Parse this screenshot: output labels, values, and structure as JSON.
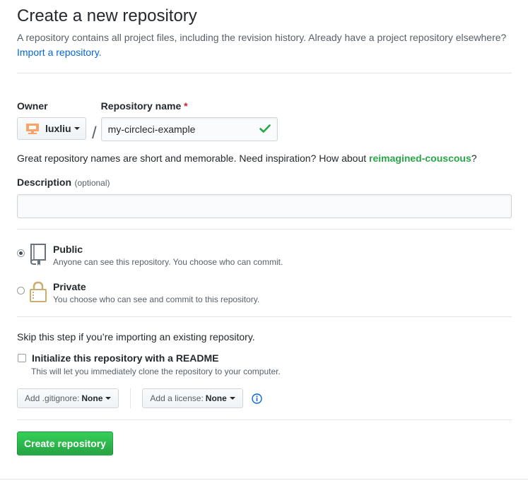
{
  "header": {
    "title": "Create a new repository",
    "description": "A repository contains all project files, including the revision history. Already have a project repository elsewhere?",
    "import_link": "Import a repository."
  },
  "owner": {
    "label": "Owner",
    "value": "luxliu"
  },
  "repo_name": {
    "label": "Repository name",
    "required_mark": "*",
    "value": "my-circleci-example"
  },
  "separator": "/",
  "hint": {
    "text": "Great repository names are short and memorable. Need inspiration? How about",
    "suggestion": "reimagined-couscous",
    "end": "?"
  },
  "description_field": {
    "label": "Description",
    "optional": "(optional)",
    "value": ""
  },
  "visibility": {
    "selected": "public",
    "options": [
      {
        "title": "Public",
        "note": "Anyone can see this repository. You choose who can commit."
      },
      {
        "title": "Private",
        "note": "You choose who can see and commit to this repository."
      }
    ]
  },
  "init": {
    "skip_text": "Skip this step if you’re importing an existing repository.",
    "label": "Initialize this repository with a README",
    "note": "This will let you immediately clone the repository to your computer.",
    "checked": false
  },
  "gitignore": {
    "label": "Add .gitignore:",
    "value": "None"
  },
  "license": {
    "label": "Add a license:",
    "value": "None"
  },
  "submit": {
    "label": "Create repository"
  },
  "colors": {
    "accent_green": "#28a745",
    "link_blue": "#0366d6",
    "required_red": "#cb2431",
    "owner_avatar": "#f66a0a"
  },
  "icons": [
    "caret-down-icon",
    "check-icon",
    "repo-icon",
    "lock-icon",
    "info-icon"
  ]
}
